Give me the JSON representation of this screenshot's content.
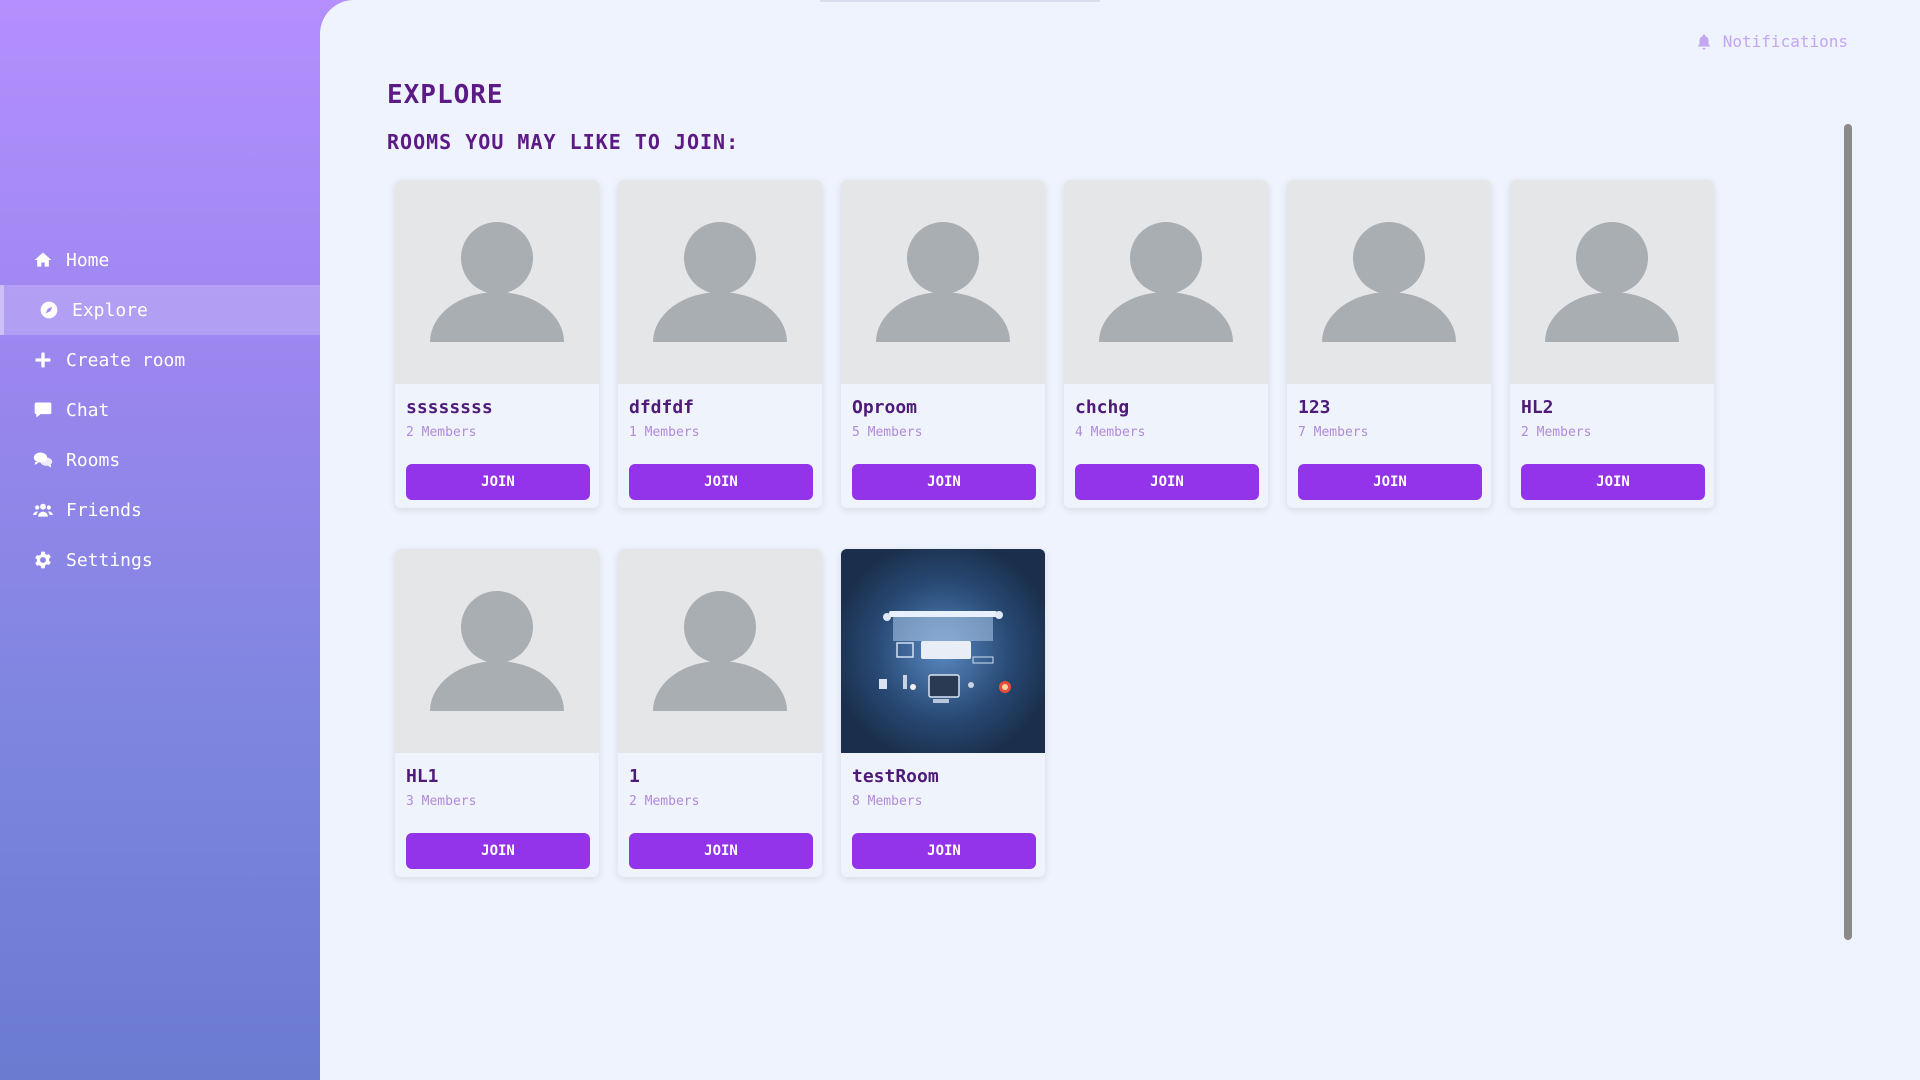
{
  "nav": {
    "items": [
      {
        "label": "Home",
        "icon": "home-icon"
      },
      {
        "label": "Explore",
        "icon": "compass-icon",
        "active": true
      },
      {
        "label": "Create room",
        "icon": "plus-icon"
      },
      {
        "label": "Chat",
        "icon": "chat-icon"
      },
      {
        "label": "Rooms",
        "icon": "comments-icon"
      },
      {
        "label": "Friends",
        "icon": "users-icon"
      },
      {
        "label": "Settings",
        "icon": "gear-icon"
      }
    ]
  },
  "header": {
    "notifications_label": "Notifications",
    "notifications_icon": "bell-icon"
  },
  "page": {
    "title": "EXPLORE",
    "subtitle": "ROOMS YOU MAY LIKE TO JOIN:"
  },
  "rooms": [
    {
      "name": "ssssssss",
      "members": "2 Members",
      "join_label": "JOIN",
      "image": "avatar-placeholder"
    },
    {
      "name": "dfdfdf",
      "members": "1 Members",
      "join_label": "JOIN",
      "image": "avatar-placeholder"
    },
    {
      "name": "Oproom",
      "members": "5 Members",
      "join_label": "JOIN",
      "image": "avatar-placeholder"
    },
    {
      "name": "chchg",
      "members": "4 Members",
      "join_label": "JOIN",
      "image": "avatar-placeholder"
    },
    {
      "name": "123",
      "members": "7 Members",
      "join_label": "JOIN",
      "image": "avatar-placeholder"
    },
    {
      "name": "HL2",
      "members": "2 Members",
      "join_label": "JOIN",
      "image": "avatar-placeholder"
    },
    {
      "name": "HL1",
      "members": "3 Members",
      "join_label": "JOIN",
      "image": "avatar-placeholder"
    },
    {
      "name": "1",
      "members": "2 Members",
      "join_label": "JOIN",
      "image": "avatar-placeholder"
    },
    {
      "name": "testRoom",
      "members": "8 Members",
      "join_label": "JOIN",
      "image": "desk-illustration"
    }
  ],
  "colors": {
    "accent": "#9333ea",
    "title": "#5b1a84",
    "members_text": "#b18ad9",
    "main_bg": "#eef3fd"
  }
}
